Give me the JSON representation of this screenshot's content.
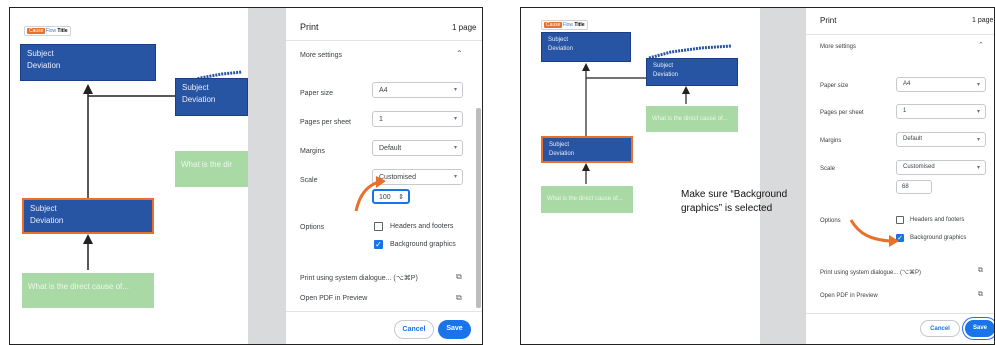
{
  "app": {
    "brand_a": "Cause",
    "brand_b": "Flow",
    "doc_title": "Title"
  },
  "diagram": {
    "node_subject": "Subject",
    "node_deviation": "Deviation",
    "question_full": "What is the direct cause of...",
    "question_cut": "What is the dir"
  },
  "print": {
    "title": "Print",
    "pages": "1 page",
    "more_settings": "More settings",
    "paper_size_label": "Paper size",
    "paper_size_value": "A4",
    "pages_per_sheet_label": "Pages per sheet",
    "pages_per_sheet_value": "1",
    "margins_label": "Margins",
    "margins_value": "Default",
    "scale_label": "Scale",
    "scale_value": "Customised",
    "scale_input_1": "100",
    "scale_input_2": "68",
    "stepper": "⇕",
    "options_label": "Options",
    "headers_footers": "Headers and footers",
    "background_graphics": "Background graphics",
    "system_dialogue": "Print using system dialogue... (⌥⌘P)",
    "open_pdf": "Open PDF in Preview",
    "cancel": "Cancel",
    "save": "Save"
  },
  "annotation": {
    "line1": "Make sure “Background",
    "line2": "graphics” is selected"
  },
  "colors": {
    "node_blue": "#2754a3",
    "node_green": "#a9d9a5",
    "highlight_orange": "#e8702a",
    "chrome_blue": "#1a73e8"
  },
  "icons": {
    "chevron": "chevron-down-icon",
    "collapse": "chevron-up-icon",
    "open_external": "open-external-icon",
    "check": "checkmark-icon",
    "arrow": "annotation-arrow-icon"
  }
}
